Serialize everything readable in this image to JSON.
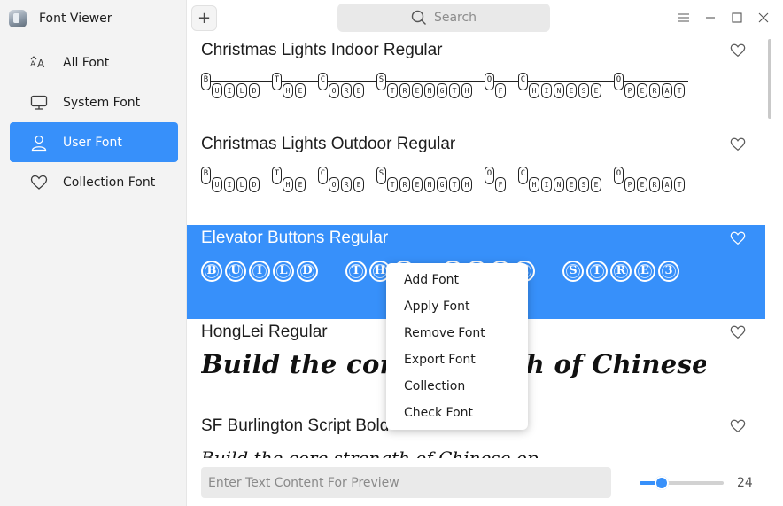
{
  "app": {
    "title": "Font Viewer"
  },
  "sidebar": {
    "items": [
      {
        "label": "All Font",
        "icon": "all-font-icon",
        "active": false
      },
      {
        "label": "System Font",
        "icon": "monitor-icon",
        "active": false
      },
      {
        "label": "User Font",
        "icon": "user-icon",
        "active": true
      },
      {
        "label": "Collection Font",
        "icon": "heart-icon",
        "active": false
      }
    ]
  },
  "topbar": {
    "add_label": "+",
    "search_placeholder": "Search"
  },
  "fonts": [
    {
      "name": "Christmas Lights Indoor Regular",
      "preview": "Build the core strength of Chinese operat"
    },
    {
      "name": "Christmas Lights Outdoor Regular",
      "preview": "Build the core strength of Chinese operat"
    },
    {
      "name": "Elevator Buttons Regular",
      "preview": "BUILD THE CORE STRE3"
    },
    {
      "name": "HongLei Regular",
      "preview": "Build the core strength of Chinese operating…"
    },
    {
      "name": "SF Burlington Script Bold",
      "preview": "Build the core strength of Chinese operating system"
    }
  ],
  "context_menu": {
    "items": [
      "Add Font",
      "Apply Font",
      "Remove Font",
      "Export Font",
      "Collection",
      "Check Font"
    ]
  },
  "bottombar": {
    "preview_placeholder": "Enter Text Content For Preview",
    "font_size": "24",
    "slider_fraction": 0.26
  },
  "colors": {
    "accent": "#3790fa",
    "sidebar_bg": "#f3f3f3"
  }
}
